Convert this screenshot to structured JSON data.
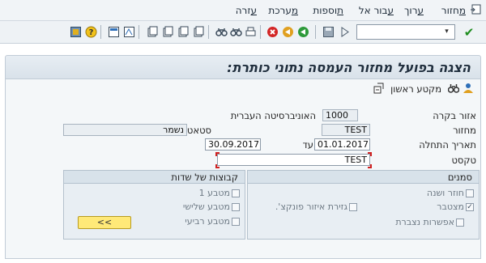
{
  "menu": [
    {
      "label": "מחזור",
      "accel": "מ"
    },
    {
      "label": "ערוך",
      "accel": "ע"
    },
    {
      "label": "עבור אל",
      "accel": "ע"
    },
    {
      "label": "תוספות",
      "accel": "ת"
    },
    {
      "label": "מערכת",
      "accel": "מ"
    },
    {
      "label": "עזרה",
      "accel": "ע"
    }
  ],
  "toolbar": {
    "command_field": {
      "value": "",
      "placeholder": ""
    },
    "dropdown_symbol": "▾",
    "enter_symbol": "✔"
  },
  "page": {
    "title": "הצגה בפועל מחזור העמסה נתוני כותרת:"
  },
  "app_toolbar": {
    "first_section_label": "מקטע ראשון"
  },
  "form": {
    "area_label": "אזור בקרה",
    "area_code": "1000",
    "area_name": "האוניברסיטה העברית",
    "cycle_label": "מחזור",
    "cycle_value": "TEST",
    "status_label": "סטאטוס",
    "status_value": "נשמר",
    "start_date_label": "תאריך התחלה",
    "start_date_value": "01.01.2017",
    "to_label": "עד",
    "end_date_value": "30.09.2017",
    "text_label": "טקסט",
    "text_value": "TEST"
  },
  "flags_group": {
    "title": "סמנים",
    "items": [
      {
        "label": "חוזר ושנה",
        "checked": false
      },
      {
        "label": "מצטבר",
        "checked": true
      },
      {
        "label": "גזירת איזור פונקצ'.",
        "checked": false
      },
      {
        "label": "אפשרות נצברת",
        "checked": false
      }
    ]
  },
  "field_groups": {
    "title": "קבוצות של שדות",
    "items": [
      {
        "label": "מטבע 1",
        "checked": false
      },
      {
        "label": "מטבע שלישי",
        "checked": false
      },
      {
        "label": "מטבע רביעי",
        "checked": false
      }
    ],
    "button_label": "<<"
  },
  "colors": {
    "accent_button": "#ffe978",
    "enter_green": "#1e8d1e",
    "focus_marker": "#d02020"
  }
}
